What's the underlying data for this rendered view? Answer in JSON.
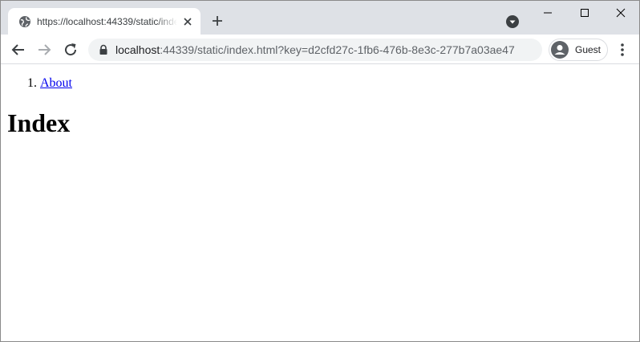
{
  "browser": {
    "tab": {
      "title": "https://localhost:44339/static/index.html?key=d2cfd27c-1fb6-476b-8e3c-277b7a03ae47",
      "favicon": "globe-icon"
    },
    "address": {
      "host": "localhost",
      "rest": ":44339/static/index.html?key=d2cfd27c-1fb6-476b-8e3c-277b7a03ae47"
    },
    "profile_label": "Guest"
  },
  "page": {
    "breadcrumb": [
      {
        "number": "1.",
        "label": "About"
      }
    ],
    "heading": "Index"
  },
  "colors": {
    "tabstrip": "#dee1e6",
    "omnibox": "#f1f3f4",
    "link": "#0000ee"
  }
}
